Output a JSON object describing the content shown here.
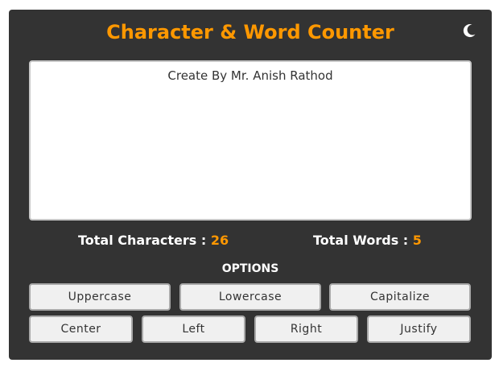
{
  "app": {
    "title": "Character & Word Counter",
    "theme_icon": "moon-icon"
  },
  "editor": {
    "value": "Create By Mr. Anish Rathod"
  },
  "stats": {
    "characters_label": "Total Characters : ",
    "characters_value": "26",
    "words_label": "Total Words : ",
    "words_value": "5"
  },
  "options": {
    "heading": "OPTIONS",
    "buttons": [
      "Uppercase",
      "Lowercase",
      "Capitalize",
      "Center",
      "Left",
      "Right",
      "Justify"
    ]
  },
  "colors": {
    "accent": "#ff9800",
    "card_background": "#333333",
    "button_background": "#f0f0f0"
  }
}
